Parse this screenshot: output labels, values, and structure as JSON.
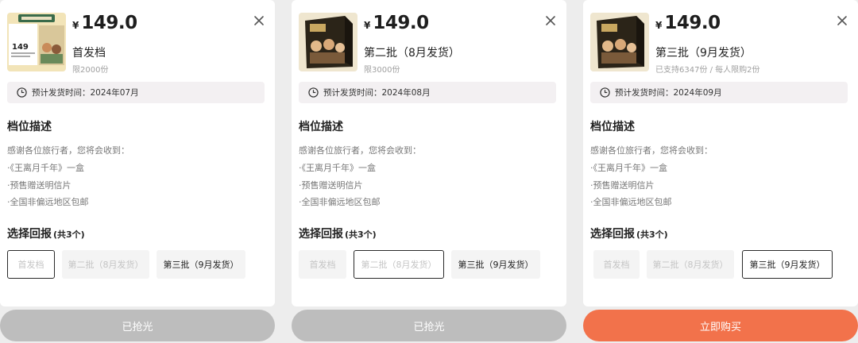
{
  "common": {
    "currency": "¥",
    "description_title": "档位描述",
    "description_intro": "感谢各位旅行者，您将会收到：",
    "description_items": [
      "·《王离月千年》一盒",
      "·预售赠送明信片",
      "·全国非偏远地区包邮"
    ],
    "choose_title": "选择回报",
    "choose_count": "(共3个)",
    "option_labels": [
      "首发档",
      "第二批（8月发货）",
      "第三批（9月发货）"
    ]
  },
  "panels": [
    {
      "price": "149.0",
      "tier_name": "首发档",
      "tier_sub": "限2000份",
      "eta": "预计发货时间：2024年07月",
      "thumb_label": "149",
      "selected_index": 0,
      "cta_label": "已抢光",
      "cta_state": "disabled"
    },
    {
      "price": "149.0",
      "tier_name": "第二批（8月发货）",
      "tier_sub": "限3000份",
      "eta": "预计发货时间：2024年08月",
      "selected_index": 1,
      "cta_label": "已抢光",
      "cta_state": "disabled"
    },
    {
      "price": "149.0",
      "tier_name": "第三批（9月发货）",
      "tier_sub": "已支持6347份 / 每人限购2份",
      "eta": "预计发货时间：2024年09月",
      "selected_index": 2,
      "cta_label": "立即购买",
      "cta_state": "enabled"
    }
  ],
  "colors": {
    "cta_active": "#f2724b",
    "cta_disabled": "#bdbdbd"
  }
}
